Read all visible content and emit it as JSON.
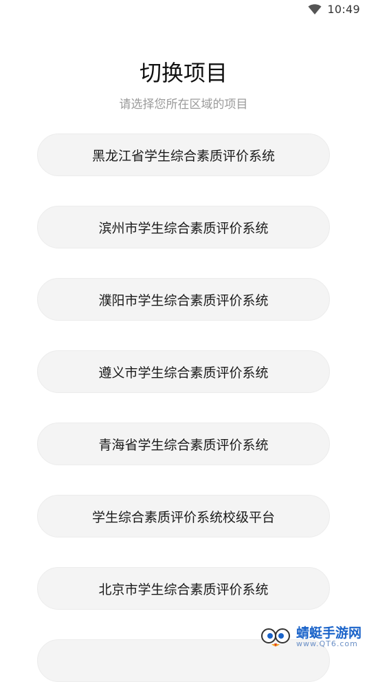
{
  "status_bar": {
    "time": "10:49",
    "wifi_icon": "wifi-icon"
  },
  "header": {
    "title": "切换项目",
    "subtitle": "请选择您所在区域的项目"
  },
  "projects": [
    {
      "label": "黑龙江省学生综合素质评价系统"
    },
    {
      "label": "滨州市学生综合素质评价系统"
    },
    {
      "label": "濮阳市学生综合素质评价系统"
    },
    {
      "label": "遵义市学生综合素质评价系统"
    },
    {
      "label": "青海省学生综合素质评价系统"
    },
    {
      "label": "学生综合素质评价系统校级平台"
    },
    {
      "label": "北京市学生综合素质评价系统"
    },
    {
      "label": ""
    }
  ],
  "watermark": {
    "brand": "蜻蜓手游网",
    "url": "www.QT6.com",
    "logo_icon": "dragonfly-logo-icon"
  },
  "colors": {
    "item_background": "#f4f4f4",
    "subtitle": "#9a9a9a",
    "watermark_brand": "#1a63c9"
  }
}
